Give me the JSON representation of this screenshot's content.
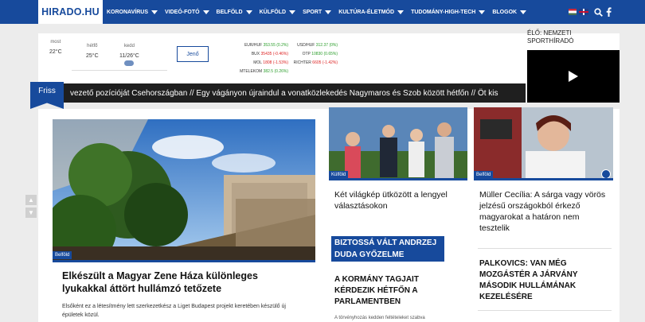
{
  "nav": {
    "logo": "HIRADO.HU",
    "items": [
      "KORONAVÍRUS",
      "VIDEÓ-FOTÓ",
      "BELFÖLD",
      "KÜLFÖLD",
      "SPORT",
      "KULTÚRA-ÉLETMÓD",
      "TUDOMÁNY-HIGH-TECH",
      "BLOGOK"
    ],
    "search_icon": "search-icon",
    "facebook_icon": "facebook-icon"
  },
  "weather": [
    {
      "day": "most",
      "temp": "22°C"
    },
    {
      "day": "hétfő",
      "temp": "25°C"
    },
    {
      "day": "kedd",
      "temp": "11/26°C"
    }
  ],
  "nameday": "Jenő",
  "stocks_left": [
    {
      "name": "EUR/HUF",
      "val": "353.55",
      "chg": "(0.2%)",
      "dir": "up"
    },
    {
      "name": "BUX",
      "val": "35435",
      "chg": "(-0.46%)",
      "dir": "dn"
    },
    {
      "name": "MOL",
      "val": "1808",
      "chg": "(-1.53%)",
      "dir": "dn"
    },
    {
      "name": "MTELEKOM",
      "val": "382.5",
      "chg": "(0.26%)",
      "dir": "up"
    }
  ],
  "stocks_right": [
    {
      "name": "USD/HUF",
      "val": "312.37",
      "chg": "(0%)",
      "dir": "up"
    },
    {
      "name": "OTP",
      "val": "10830",
      "chg": "(0.65%)",
      "dir": "up"
    },
    {
      "name": "RICHTER",
      "val": "6605",
      "chg": "(-1.42%)",
      "dir": "dn"
    }
  ],
  "ticker": {
    "label": "Friss",
    "text": "vezető pozícióját Csehországban // Egy vágányon újraindul a vonatközlekedés Nagymaros és Szob között hétfőn // Öt kis"
  },
  "live": {
    "label_line1": "ÉLŐ: NEMZETI",
    "label_line2": "SPORTHÍRADÓ"
  },
  "main_article": {
    "tag": "Belföld",
    "title": "Elkészült a Magyar Zene Háza különleges lyukakkal áttört hullámzó tetőzete",
    "lead": "Elsőként ez a létesítmény lett szerkezetkész a Liget Budapest projekt keretében készülő új épületek közül."
  },
  "card1": {
    "tag": "Külföld",
    "title": "Két világkép ütközött a lengyel választásokon"
  },
  "card2": {
    "tag": "Belföld",
    "title": "Müller Cecília: A sárga vagy vörös jelzésű országokból érkező magyarokat a határon nem tesztelik"
  },
  "highlight": "BIZTOSSÁ VÁLT ANDRZEJ DUDA GYŐZELME",
  "article3": {
    "title": "A KORMÁNY TAGJAIT KÉRDEZIK HÉTFŐN A PARLAMENTBEN",
    "lead": "A törvényhozás kedden feltételeket szabva"
  },
  "article4": {
    "title": "PALKOVICS: VAN MÉG MOZGÁSTÉR A JÁRVÁNY MÁSODIK HULLÁMÁNAK KEZELÉSÉRE"
  },
  "colors": {
    "brand": "#174a9c",
    "ticker_bg": "#1f1f1f"
  }
}
